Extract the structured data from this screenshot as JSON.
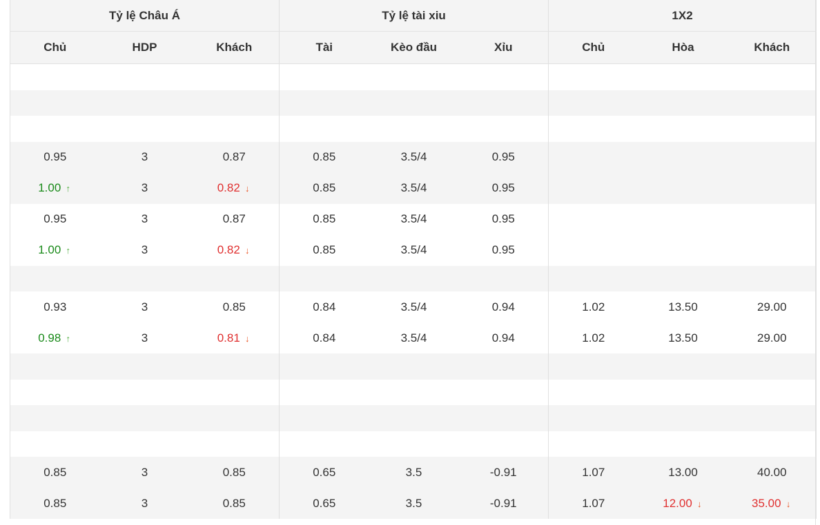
{
  "headers": {
    "groups": [
      "Tỷ lệ Châu Á",
      "Tỷ lệ tài xiu",
      "1X2"
    ],
    "columns": [
      "Chủ",
      "HDP",
      "Khách",
      "Tài",
      "Kèo đầu",
      "Xỉu",
      "Chủ",
      "Hòa",
      "Khách"
    ]
  },
  "colors": {
    "up": "#1a8a1a",
    "down": "#e03030",
    "header_bg": "#f4f4f4",
    "stripe_bg": "#f4f4f4"
  },
  "icons": {
    "up": "arrow-up-icon",
    "down": "arrow-down-icon"
  },
  "rows": [
    {
      "type": "spacer",
      "bg": false
    },
    {
      "type": "spacer",
      "bg": true
    },
    {
      "type": "spacer",
      "bg": false
    },
    {
      "type": "data",
      "bg": true,
      "cells": [
        {
          "v": "0.95"
        },
        {
          "v": "3"
        },
        {
          "v": "0.87"
        },
        {
          "v": "0.85"
        },
        {
          "v": "3.5/4"
        },
        {
          "v": "0.95"
        },
        {
          "v": ""
        },
        {
          "v": ""
        },
        {
          "v": ""
        }
      ]
    },
    {
      "type": "data",
      "bg": true,
      "cells": [
        {
          "v": "1.00",
          "d": "up"
        },
        {
          "v": "3"
        },
        {
          "v": "0.82",
          "d": "down"
        },
        {
          "v": "0.85"
        },
        {
          "v": "3.5/4"
        },
        {
          "v": "0.95"
        },
        {
          "v": ""
        },
        {
          "v": ""
        },
        {
          "v": ""
        }
      ]
    },
    {
      "type": "data",
      "bg": false,
      "cells": [
        {
          "v": "0.95"
        },
        {
          "v": "3"
        },
        {
          "v": "0.87"
        },
        {
          "v": "0.85"
        },
        {
          "v": "3.5/4"
        },
        {
          "v": "0.95"
        },
        {
          "v": ""
        },
        {
          "v": ""
        },
        {
          "v": ""
        }
      ]
    },
    {
      "type": "data",
      "bg": false,
      "cells": [
        {
          "v": "1.00",
          "d": "up"
        },
        {
          "v": "3"
        },
        {
          "v": "0.82",
          "d": "down"
        },
        {
          "v": "0.85"
        },
        {
          "v": "3.5/4"
        },
        {
          "v": "0.95"
        },
        {
          "v": ""
        },
        {
          "v": ""
        },
        {
          "v": ""
        }
      ]
    },
    {
      "type": "spacer",
      "bg": true
    },
    {
      "type": "data",
      "bg": false,
      "cells": [
        {
          "v": "0.93"
        },
        {
          "v": "3"
        },
        {
          "v": "0.85"
        },
        {
          "v": "0.84"
        },
        {
          "v": "3.5/4"
        },
        {
          "v": "0.94"
        },
        {
          "v": "1.02"
        },
        {
          "v": "13.50"
        },
        {
          "v": "29.00"
        }
      ]
    },
    {
      "type": "data",
      "bg": false,
      "cells": [
        {
          "v": "0.98",
          "d": "up"
        },
        {
          "v": "3"
        },
        {
          "v": "0.81",
          "d": "down"
        },
        {
          "v": "0.84"
        },
        {
          "v": "3.5/4"
        },
        {
          "v": "0.94"
        },
        {
          "v": "1.02"
        },
        {
          "v": "13.50"
        },
        {
          "v": "29.00"
        }
      ]
    },
    {
      "type": "spacer",
      "bg": true
    },
    {
      "type": "spacer",
      "bg": false
    },
    {
      "type": "spacer",
      "bg": true
    },
    {
      "type": "spacer",
      "bg": false
    },
    {
      "type": "data",
      "bg": true,
      "cells": [
        {
          "v": "0.85"
        },
        {
          "v": "3"
        },
        {
          "v": "0.85"
        },
        {
          "v": "0.65"
        },
        {
          "v": "3.5"
        },
        {
          "v": "-0.91"
        },
        {
          "v": "1.07"
        },
        {
          "v": "13.00"
        },
        {
          "v": "40.00"
        }
      ]
    },
    {
      "type": "data",
      "bg": true,
      "cells": [
        {
          "v": "0.85"
        },
        {
          "v": "3"
        },
        {
          "v": "0.85"
        },
        {
          "v": "0.65"
        },
        {
          "v": "3.5"
        },
        {
          "v": "-0.91"
        },
        {
          "v": "1.07"
        },
        {
          "v": "12.00",
          "d": "down"
        },
        {
          "v": "35.00",
          "d": "down"
        }
      ]
    }
  ]
}
